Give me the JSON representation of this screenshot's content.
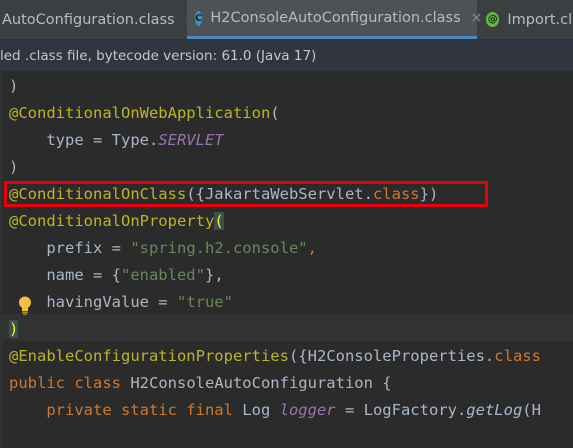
{
  "tabs": [
    {
      "label": "AutoConfiguration.class",
      "close": "×",
      "active": false
    },
    {
      "label": "H2ConsoleAutoConfiguration.class",
      "close": "×",
      "icon": "C",
      "active": true
    },
    {
      "label": "Import.cla",
      "icon": "@",
      "active": false
    }
  ],
  "banner": {
    "text": "led .class file, bytecode version: 61.0 (Java 17)"
  },
  "code": {
    "l1_paren": ")",
    "l2_ann": "@ConditionalOnWebApplication",
    "l2_paren": "(",
    "l3_key": "    type = Type.",
    "l3_const": "SERVLET",
    "l4_paren": ")",
    "l5_ann": "@ConditionalOnClass",
    "l5_open": "({JakartaWebServlet.",
    "l5_kw": "class",
    "l5_close": "})",
    "l6_ann": "@ConditionalOnProperty",
    "l6_paren": "(",
    "l7_key": "    prefix = ",
    "l7_str": "\"spring.h2.console\"",
    "l7_comma": ",",
    "l8_key": "    name = {",
    "l8_str": "\"enabled\"",
    "l8_close": "},",
    "l9_key": "    havingValue = ",
    "l9_str": "\"true\"",
    "l10_paren": ")",
    "l11_ann": "@EnableConfigurationProperties",
    "l11_rest": "({H2ConsoleProperties.",
    "l11_kw": "class",
    "l12_kw": "public class ",
    "l12_rest": "H2ConsoleAutoConfiguration {",
    "l13_kw": "    private static final ",
    "l13_type": "Log ",
    "l13_fld": "logger",
    "l13_eq": " = LogFactory.",
    "l13_mth": "getLog",
    "l13_end": "(H"
  },
  "colors": {
    "annotation": "#bbb529",
    "keyword": "#cc7832",
    "string": "#6a8759",
    "highlight_box": "#e8000d"
  }
}
